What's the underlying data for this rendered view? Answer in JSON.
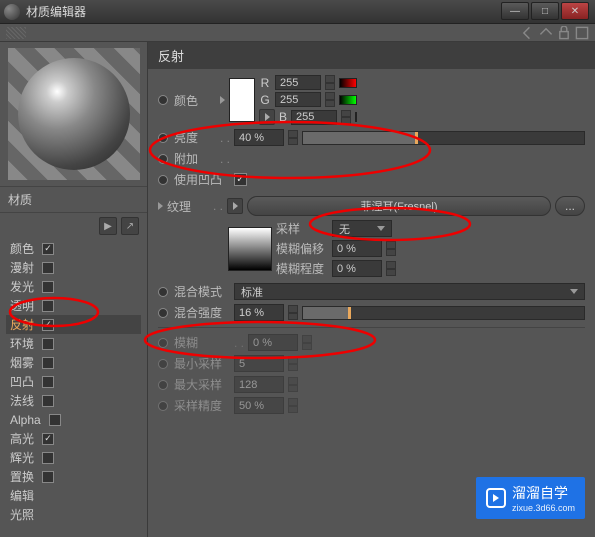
{
  "window": {
    "title": "材质编辑器"
  },
  "material_name": "材质",
  "channels": [
    {
      "label": "颜色",
      "checked": true,
      "selected": false
    },
    {
      "label": "漫射",
      "checked": false,
      "selected": false
    },
    {
      "label": "发光",
      "checked": false,
      "selected": false
    },
    {
      "label": "透明",
      "checked": false,
      "selected": false
    },
    {
      "label": "反射",
      "checked": true,
      "selected": true
    },
    {
      "label": "环境",
      "checked": false,
      "selected": false
    },
    {
      "label": "烟雾",
      "checked": false,
      "selected": false
    },
    {
      "label": "凹凸",
      "checked": false,
      "selected": false
    },
    {
      "label": "法线",
      "checked": false,
      "selected": false
    },
    {
      "label": "Alpha",
      "checked": false,
      "selected": false
    },
    {
      "label": "高光",
      "checked": true,
      "selected": false
    },
    {
      "label": "辉光",
      "checked": false,
      "selected": false
    },
    {
      "label": "置换",
      "checked": false,
      "selected": false
    },
    {
      "label": "编辑",
      "checked": null,
      "selected": false
    },
    {
      "label": "光照",
      "checked": null,
      "selected": false
    }
  ],
  "panel": {
    "title": "反射",
    "labels": {
      "color": "颜色",
      "brightness": "亮度",
      "additive": "附加",
      "use_bump": "使用凹凸",
      "texture": "纹理",
      "sampling": "采样",
      "blur_offset": "模糊偏移",
      "blur_scale": "模糊程度",
      "blend_mode": "混合模式",
      "mix_strength": "混合强度",
      "blurriness": "模糊",
      "min_samples": "最小采样",
      "max_samples": "最大采样",
      "sample_accuracy": "采样精度"
    },
    "rgb": {
      "R": "255",
      "G": "255",
      "B": "255"
    },
    "brightness": {
      "value": "40 %",
      "pct": 40
    },
    "use_bump_checked": true,
    "texture_name": "菲涅耳(Fresnel)",
    "sampling_value": "无",
    "blur_offset": "0 %",
    "blur_scale": "0 %",
    "blend_mode_value": "标准",
    "mix_strength": {
      "value": "16 %",
      "pct": 16
    },
    "blurriness": "0 %",
    "min_samples": "5",
    "max_samples": "128",
    "sample_accuracy": "50 %",
    "browse": "..."
  },
  "watermark": {
    "main": "溜溜自学",
    "sub": "zixue.3d66.com"
  }
}
